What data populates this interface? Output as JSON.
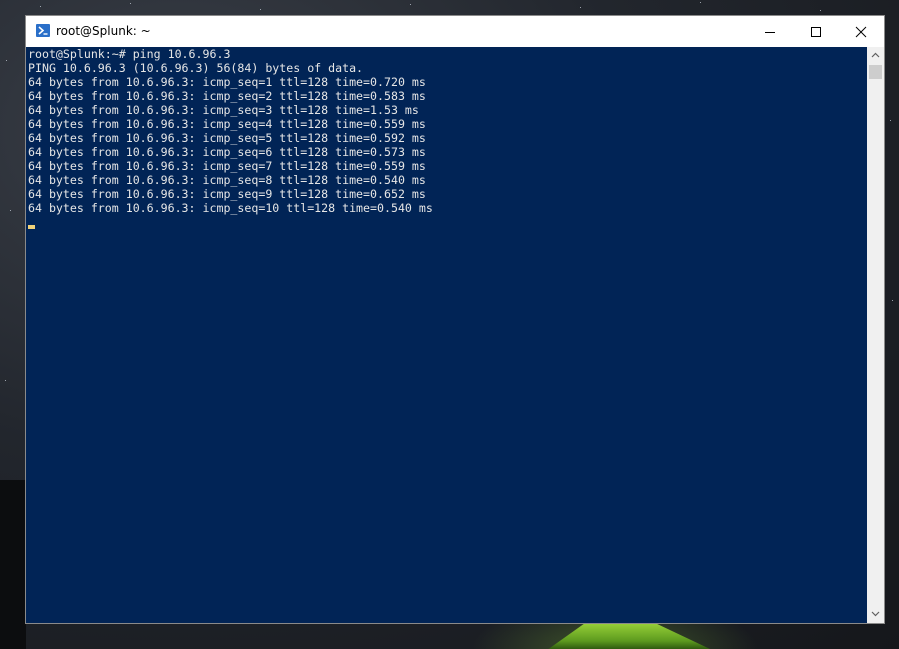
{
  "window": {
    "title": "root@Splunk: ~",
    "icon": "powershell-icon",
    "controls": {
      "minimize_icon": "minimize-icon",
      "maximize_icon": "maximize-icon",
      "close_icon": "close-icon"
    }
  },
  "terminal": {
    "background_color": "#012456",
    "text_color": "#e6e6e6",
    "lines": [
      "root@Splunk:~# ping 10.6.96.3",
      "PING 10.6.96.3 (10.6.96.3) 56(84) bytes of data.",
      "64 bytes from 10.6.96.3: icmp_seq=1 ttl=128 time=0.720 ms",
      "64 bytes from 10.6.96.3: icmp_seq=2 ttl=128 time=0.583 ms",
      "64 bytes from 10.6.96.3: icmp_seq=3 ttl=128 time=1.53 ms",
      "64 bytes from 10.6.96.3: icmp_seq=4 ttl=128 time=0.559 ms",
      "64 bytes from 10.6.96.3: icmp_seq=5 ttl=128 time=0.592 ms",
      "64 bytes from 10.6.96.3: icmp_seq=6 ttl=128 time=0.573 ms",
      "64 bytes from 10.6.96.3: icmp_seq=7 ttl=128 time=0.559 ms",
      "64 bytes from 10.6.96.3: icmp_seq=8 ttl=128 time=0.540 ms",
      "64 bytes from 10.6.96.3: icmp_seq=9 ttl=128 time=0.652 ms",
      "64 bytes from 10.6.96.3: icmp_seq=10 ttl=128 time=0.540 ms"
    ]
  },
  "scrollbar": {
    "up_icon": "scroll-up-arrow-icon",
    "down_icon": "scroll-down-arrow-icon"
  }
}
